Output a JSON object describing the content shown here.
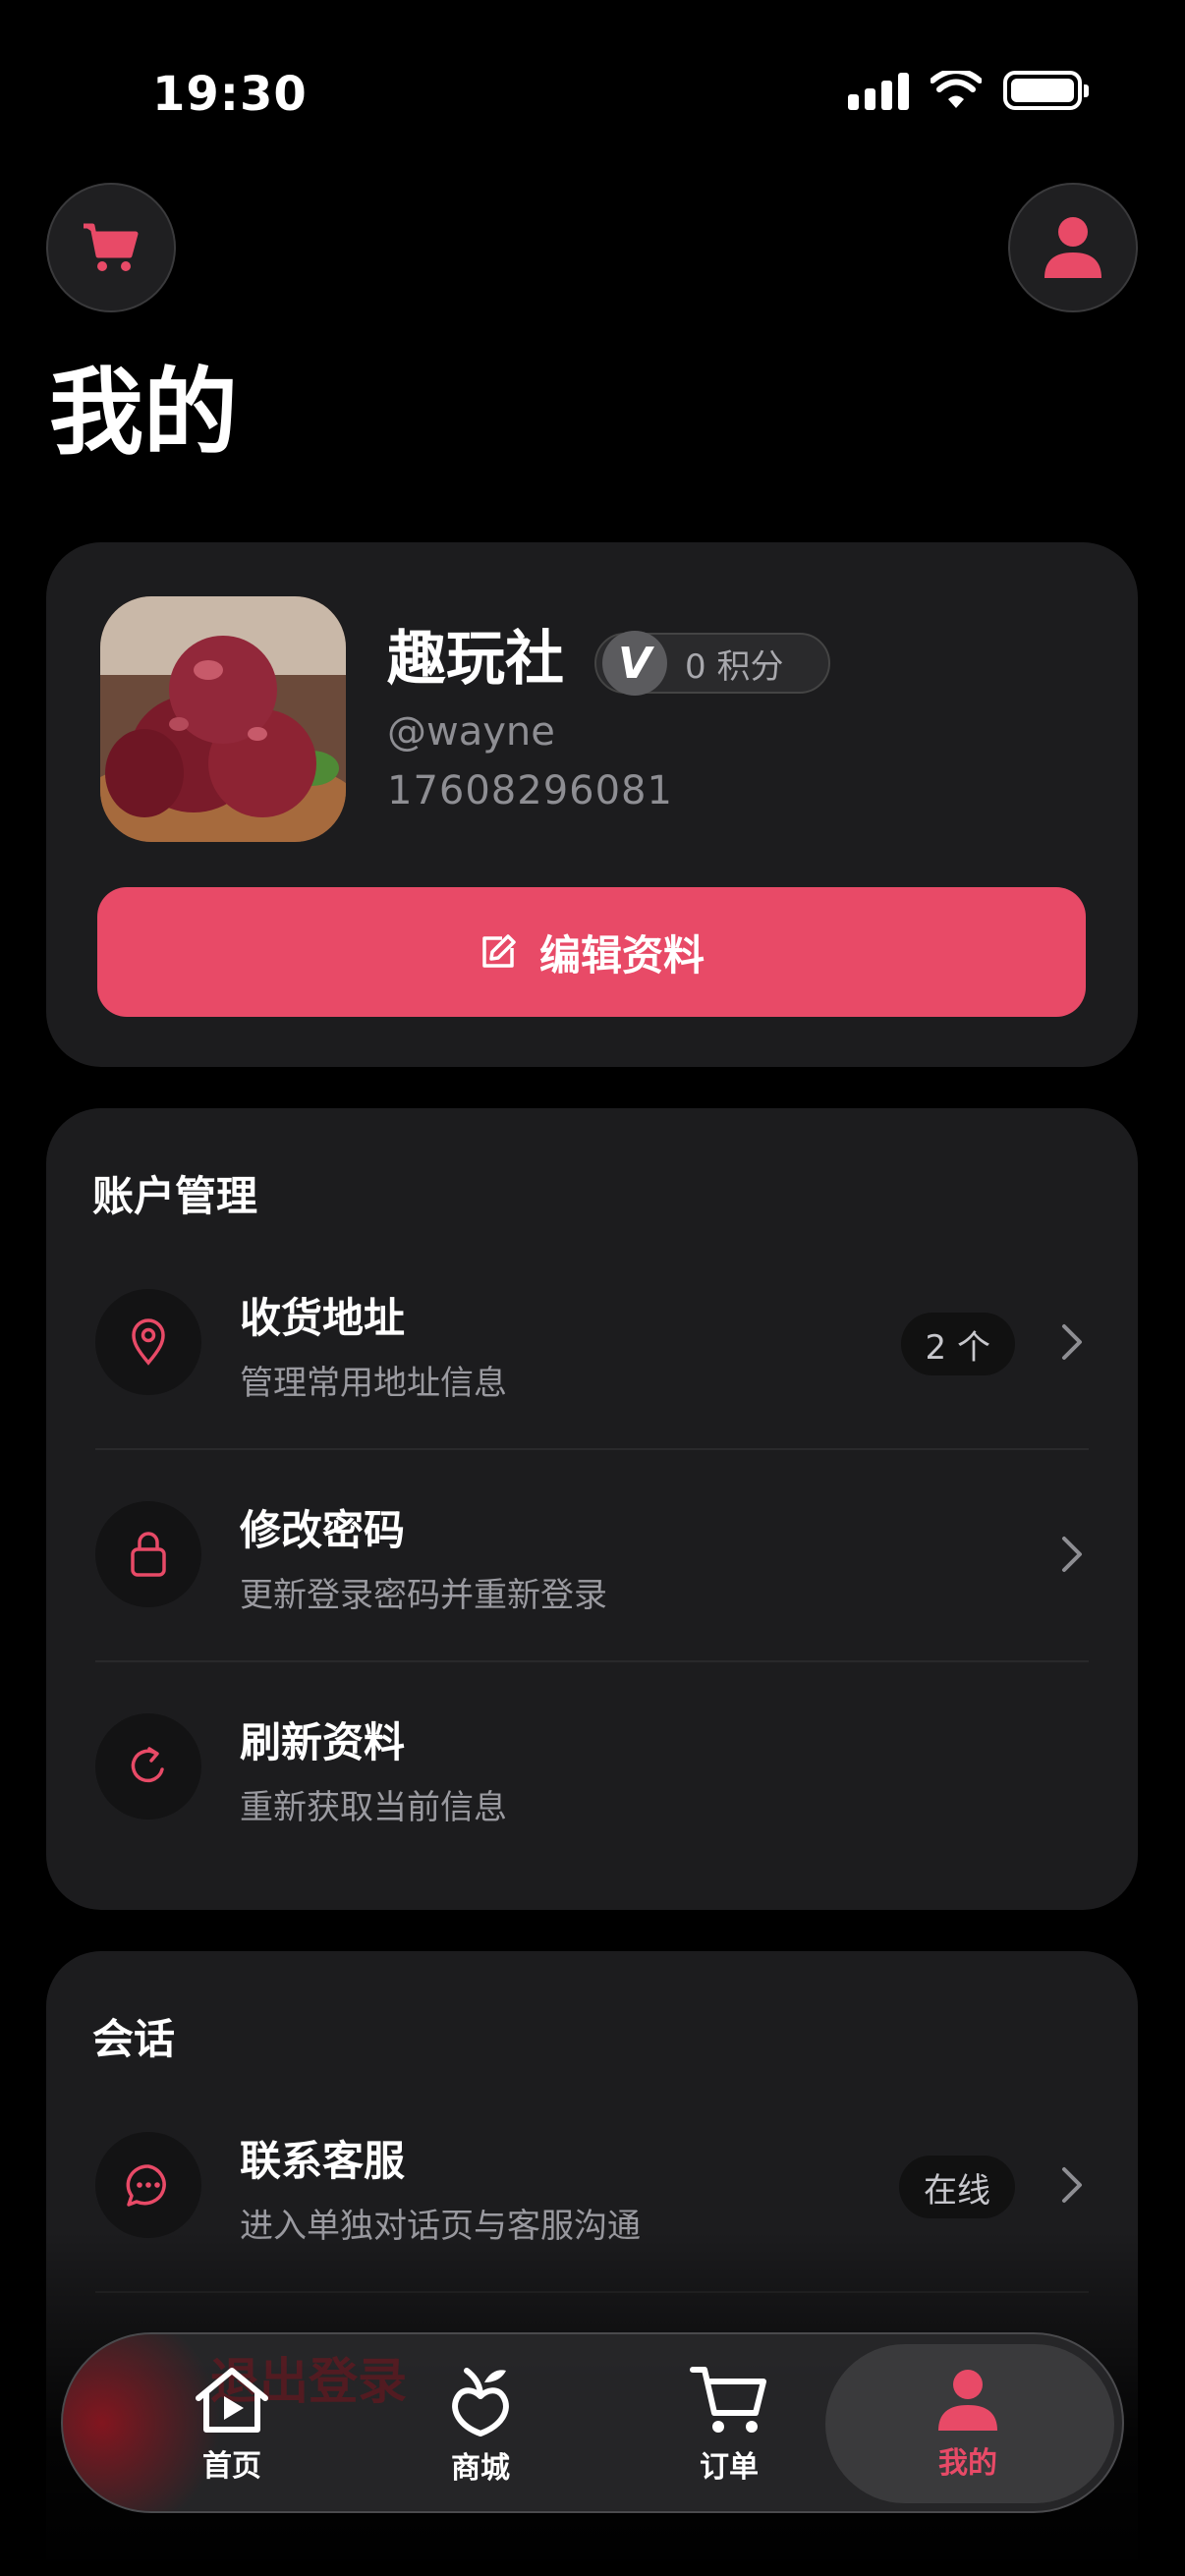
{
  "status_bar": {
    "time": "19:30"
  },
  "page": {
    "title": "我的"
  },
  "profile": {
    "name": "趣玩社",
    "points_badge": "V",
    "points": "0 积分",
    "handle": "@wayne",
    "phone": "17608296081",
    "edit_label": "编辑资料"
  },
  "account": {
    "title": "账户管理",
    "items": [
      {
        "label": "收货地址",
        "sub": "管理常用地址信息",
        "badge": "2 个",
        "icon": "location-pin-icon"
      },
      {
        "label": "修改密码",
        "sub": "更新登录密码并重新登录",
        "icon": "lock-icon"
      },
      {
        "label": "刷新资料",
        "sub": "重新获取当前信息",
        "icon": "refresh-icon"
      }
    ]
  },
  "session": {
    "title": "会话",
    "items": [
      {
        "label": "联系客服",
        "sub": "进入单独对话页与客服沟通",
        "badge": "在线",
        "icon": "chat-bubble-icon"
      }
    ],
    "partial_label": "退出登录"
  },
  "tabbar": {
    "items": [
      {
        "label": "首页",
        "icon": "home-play-icon"
      },
      {
        "label": "商城",
        "icon": "fruit-icon"
      },
      {
        "label": "订单",
        "icon": "cart-icon"
      },
      {
        "label": "我的",
        "icon": "user-icon",
        "active": true
      }
    ]
  },
  "colors": {
    "accent": "#e84a67",
    "card": "#1c1c1e",
    "background": "#000000"
  }
}
